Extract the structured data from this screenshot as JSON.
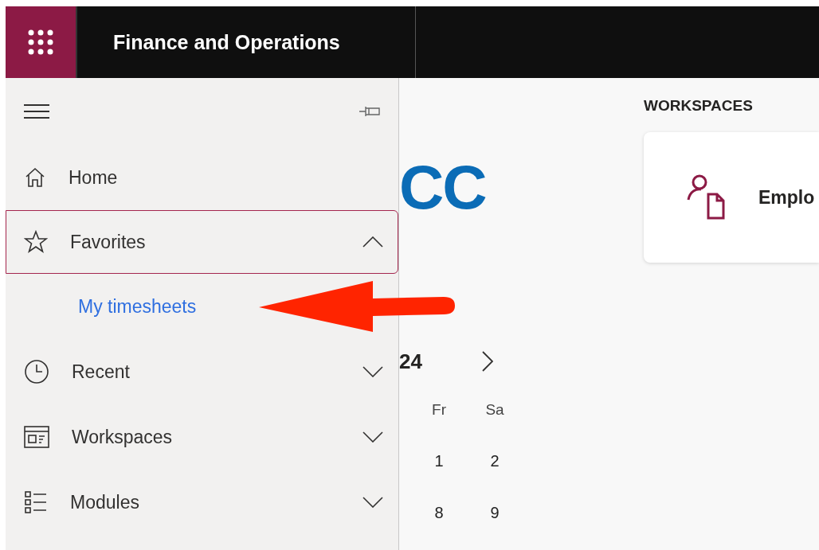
{
  "app": {
    "title": "Finance and Operations"
  },
  "nav": {
    "items": [
      {
        "label": "Home",
        "kind": "link",
        "selected": false
      },
      {
        "label": "Favorites",
        "kind": "group",
        "selected": true,
        "expanded": true,
        "children": [
          {
            "label": "My timesheets"
          }
        ]
      },
      {
        "label": "Recent",
        "kind": "group",
        "selected": false,
        "expanded": false
      },
      {
        "label": "Workspaces",
        "kind": "group",
        "selected": false,
        "expanded": false
      },
      {
        "label": "Modules",
        "kind": "group",
        "selected": false,
        "expanded": false
      }
    ]
  },
  "main": {
    "logo": "CC",
    "calendar": {
      "month_fragment": "24",
      "weekdays": [
        "Fr",
        "Sa"
      ],
      "weeks": [
        [
          "1",
          "2"
        ],
        [
          "8",
          "9"
        ]
      ]
    },
    "workspaces": {
      "heading": "WORKSPACES",
      "tiles": [
        {
          "label": "Emplo"
        }
      ]
    }
  }
}
